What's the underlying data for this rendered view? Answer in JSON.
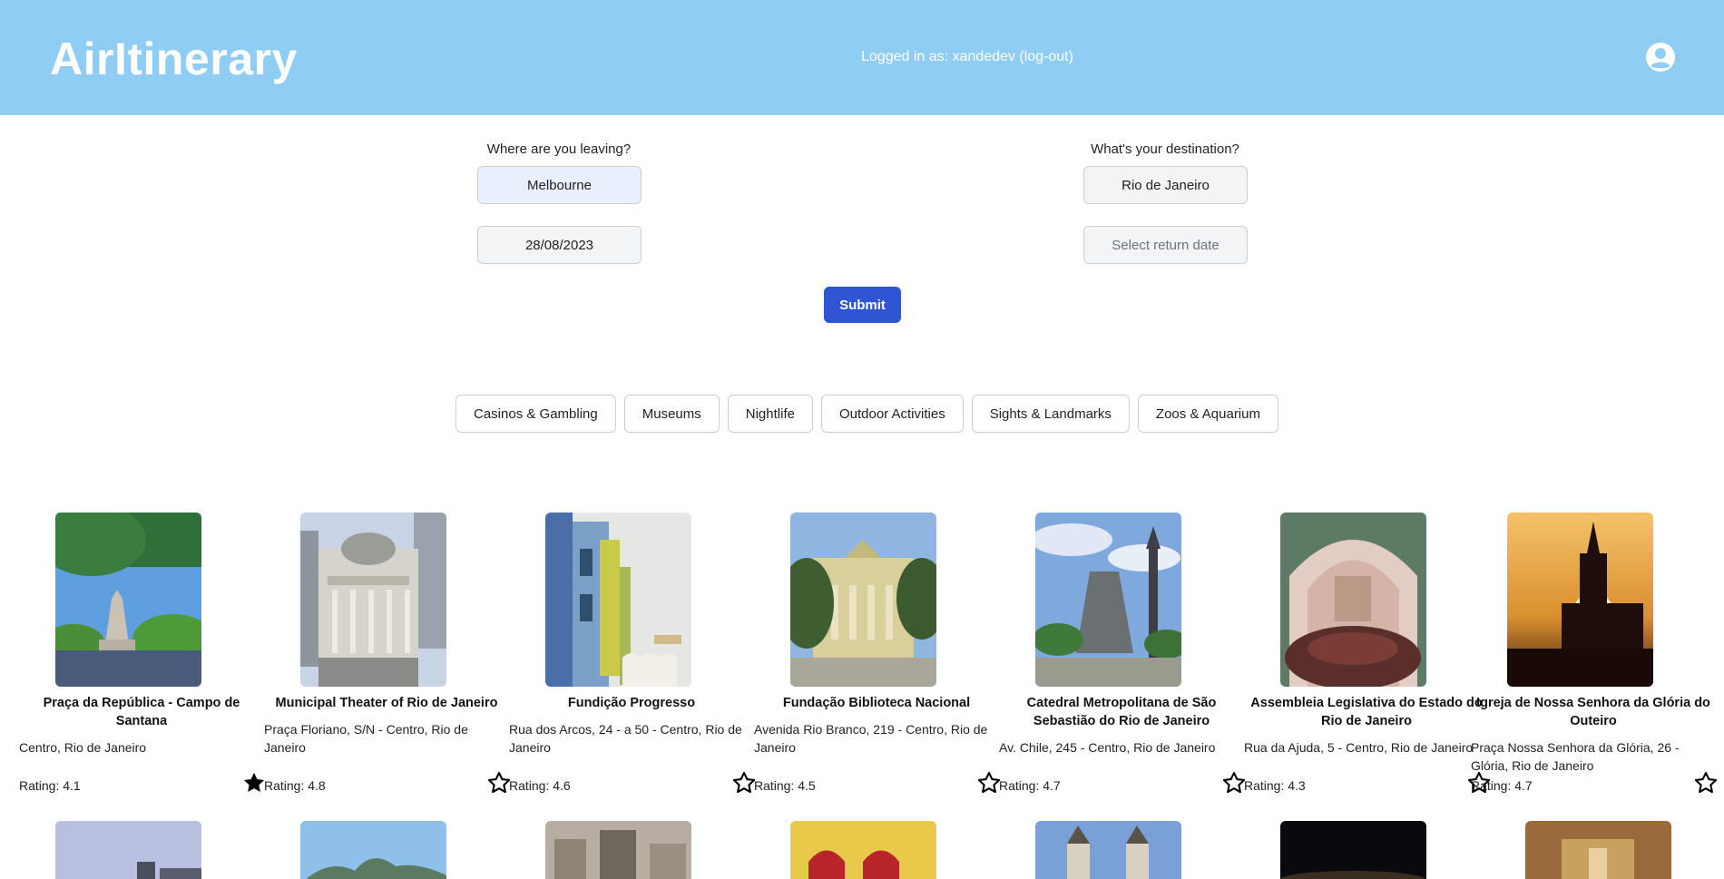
{
  "header": {
    "logo": "AirItinerary",
    "login_status": "Logged in as: xandedev (log-out)",
    "profile_icon": "user-circle-icon"
  },
  "search": {
    "origin_label": "Where are you leaving?",
    "origin_value": "Melbourne",
    "destination_label": "What's your destination?",
    "destination_value": "Rio de Janeiro",
    "departure_date": "28/08/2023",
    "return_placeholder": "Select return date",
    "submit_label": "Submit"
  },
  "categories": [
    "Casinos & Gambling",
    "Museums",
    "Nightlife",
    "Outdoor Activities",
    "Sights & Landmarks",
    "Zoos & Aquarium"
  ],
  "cards": [
    {
      "name": "Praça da República - Campo de Santana",
      "address": "Centro, Rio de Janeiro",
      "rating": "Rating: 4.1",
      "favorite": true
    },
    {
      "name": "Municipal Theater of Rio de Janeiro",
      "address": "Praça Floriano, S/N - Centro, Rio de Janeiro",
      "rating": "Rating: 4.8",
      "favorite": false
    },
    {
      "name": "Fundição Progresso",
      "address": "Rua dos Arcos, 24 - a 50 - Centro, Rio de Janeiro",
      "rating": "Rating: 4.6",
      "favorite": false
    },
    {
      "name": "Fundação Biblioteca Nacional",
      "address": "Avenida Rio Branco, 219 - Centro, Rio de Janeiro",
      "rating": "Rating: 4.5",
      "favorite": false
    },
    {
      "name": "Catedral Metropolitana de São Sebastião do Rio de Janeiro",
      "address": "Av. Chile, 245 - Centro, Rio de Janeiro",
      "rating": "Rating: 4.7",
      "favorite": false
    },
    {
      "name": "Assembleia Legislativa do Estado do Rio de Janeiro",
      "address": "Rua da Ajuda, 5 - Centro, Rio de Janeiro",
      "rating": "Rating: 4.3",
      "favorite": false
    },
    {
      "name": "Igreja de Nossa Senhora da Glória do Outeiro",
      "address": "Praça Nossa Senhora da Glória, 26 - Glória, Rio de Janeiro",
      "rating": "Rating: 4.7",
      "favorite": false
    }
  ],
  "icons": {
    "favorite": "star-filled-icon",
    "not_favorite": "star-outline-icon"
  }
}
